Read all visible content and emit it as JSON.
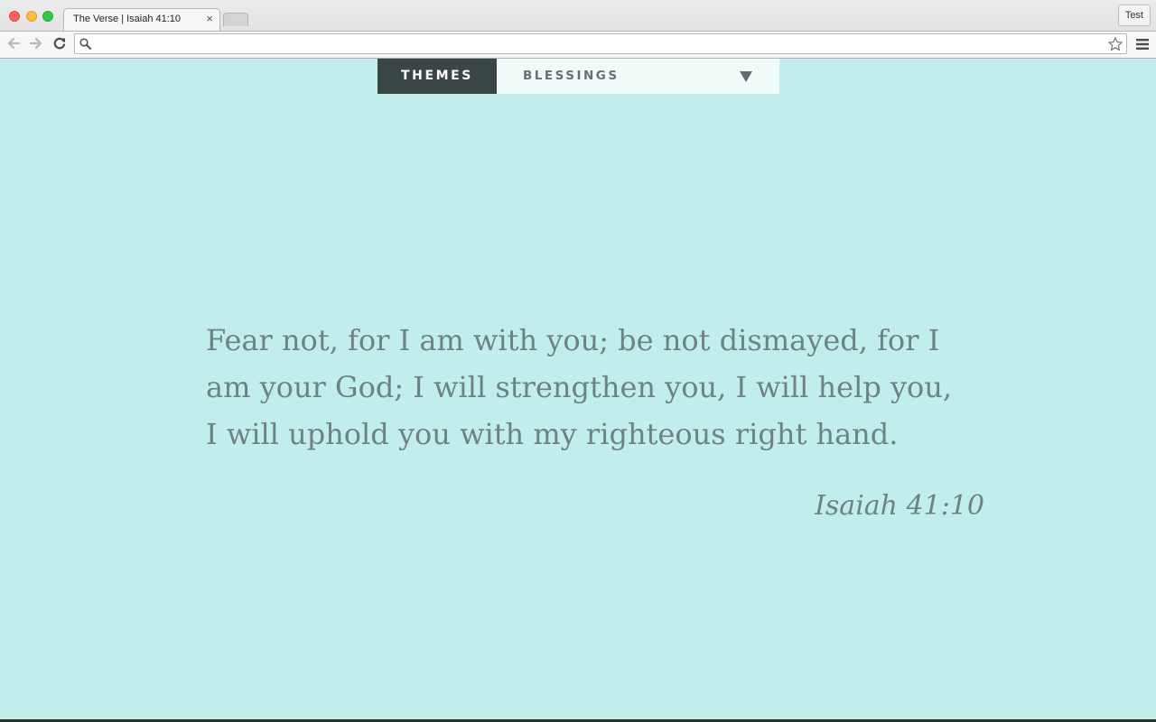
{
  "browser": {
    "tab_title": "The Verse | Isaiah 41:10",
    "tab_close": "×",
    "profile_label": "Test",
    "address_value": "",
    "address_placeholder": ""
  },
  "page": {
    "nav": {
      "themes_label": "THEMES",
      "category_selected": "BLESSINGS"
    },
    "verse_text": "Fear not, for I am with you; be not dismayed, for I am your God; I will strengthen you, I will help you, I will uphold you with my righteous right hand.",
    "verse_reference": "Isaiah 41:10"
  },
  "colors": {
    "background": "#c1eeea",
    "themes_button": "#3a4646",
    "select_background": "#f0faf9",
    "verse_text": "#6f8282"
  },
  "icons": [
    "back-arrow-icon",
    "forward-arrow-icon",
    "reload-icon",
    "search-icon",
    "star-icon",
    "menu-icon",
    "chevron-down-icon"
  ]
}
